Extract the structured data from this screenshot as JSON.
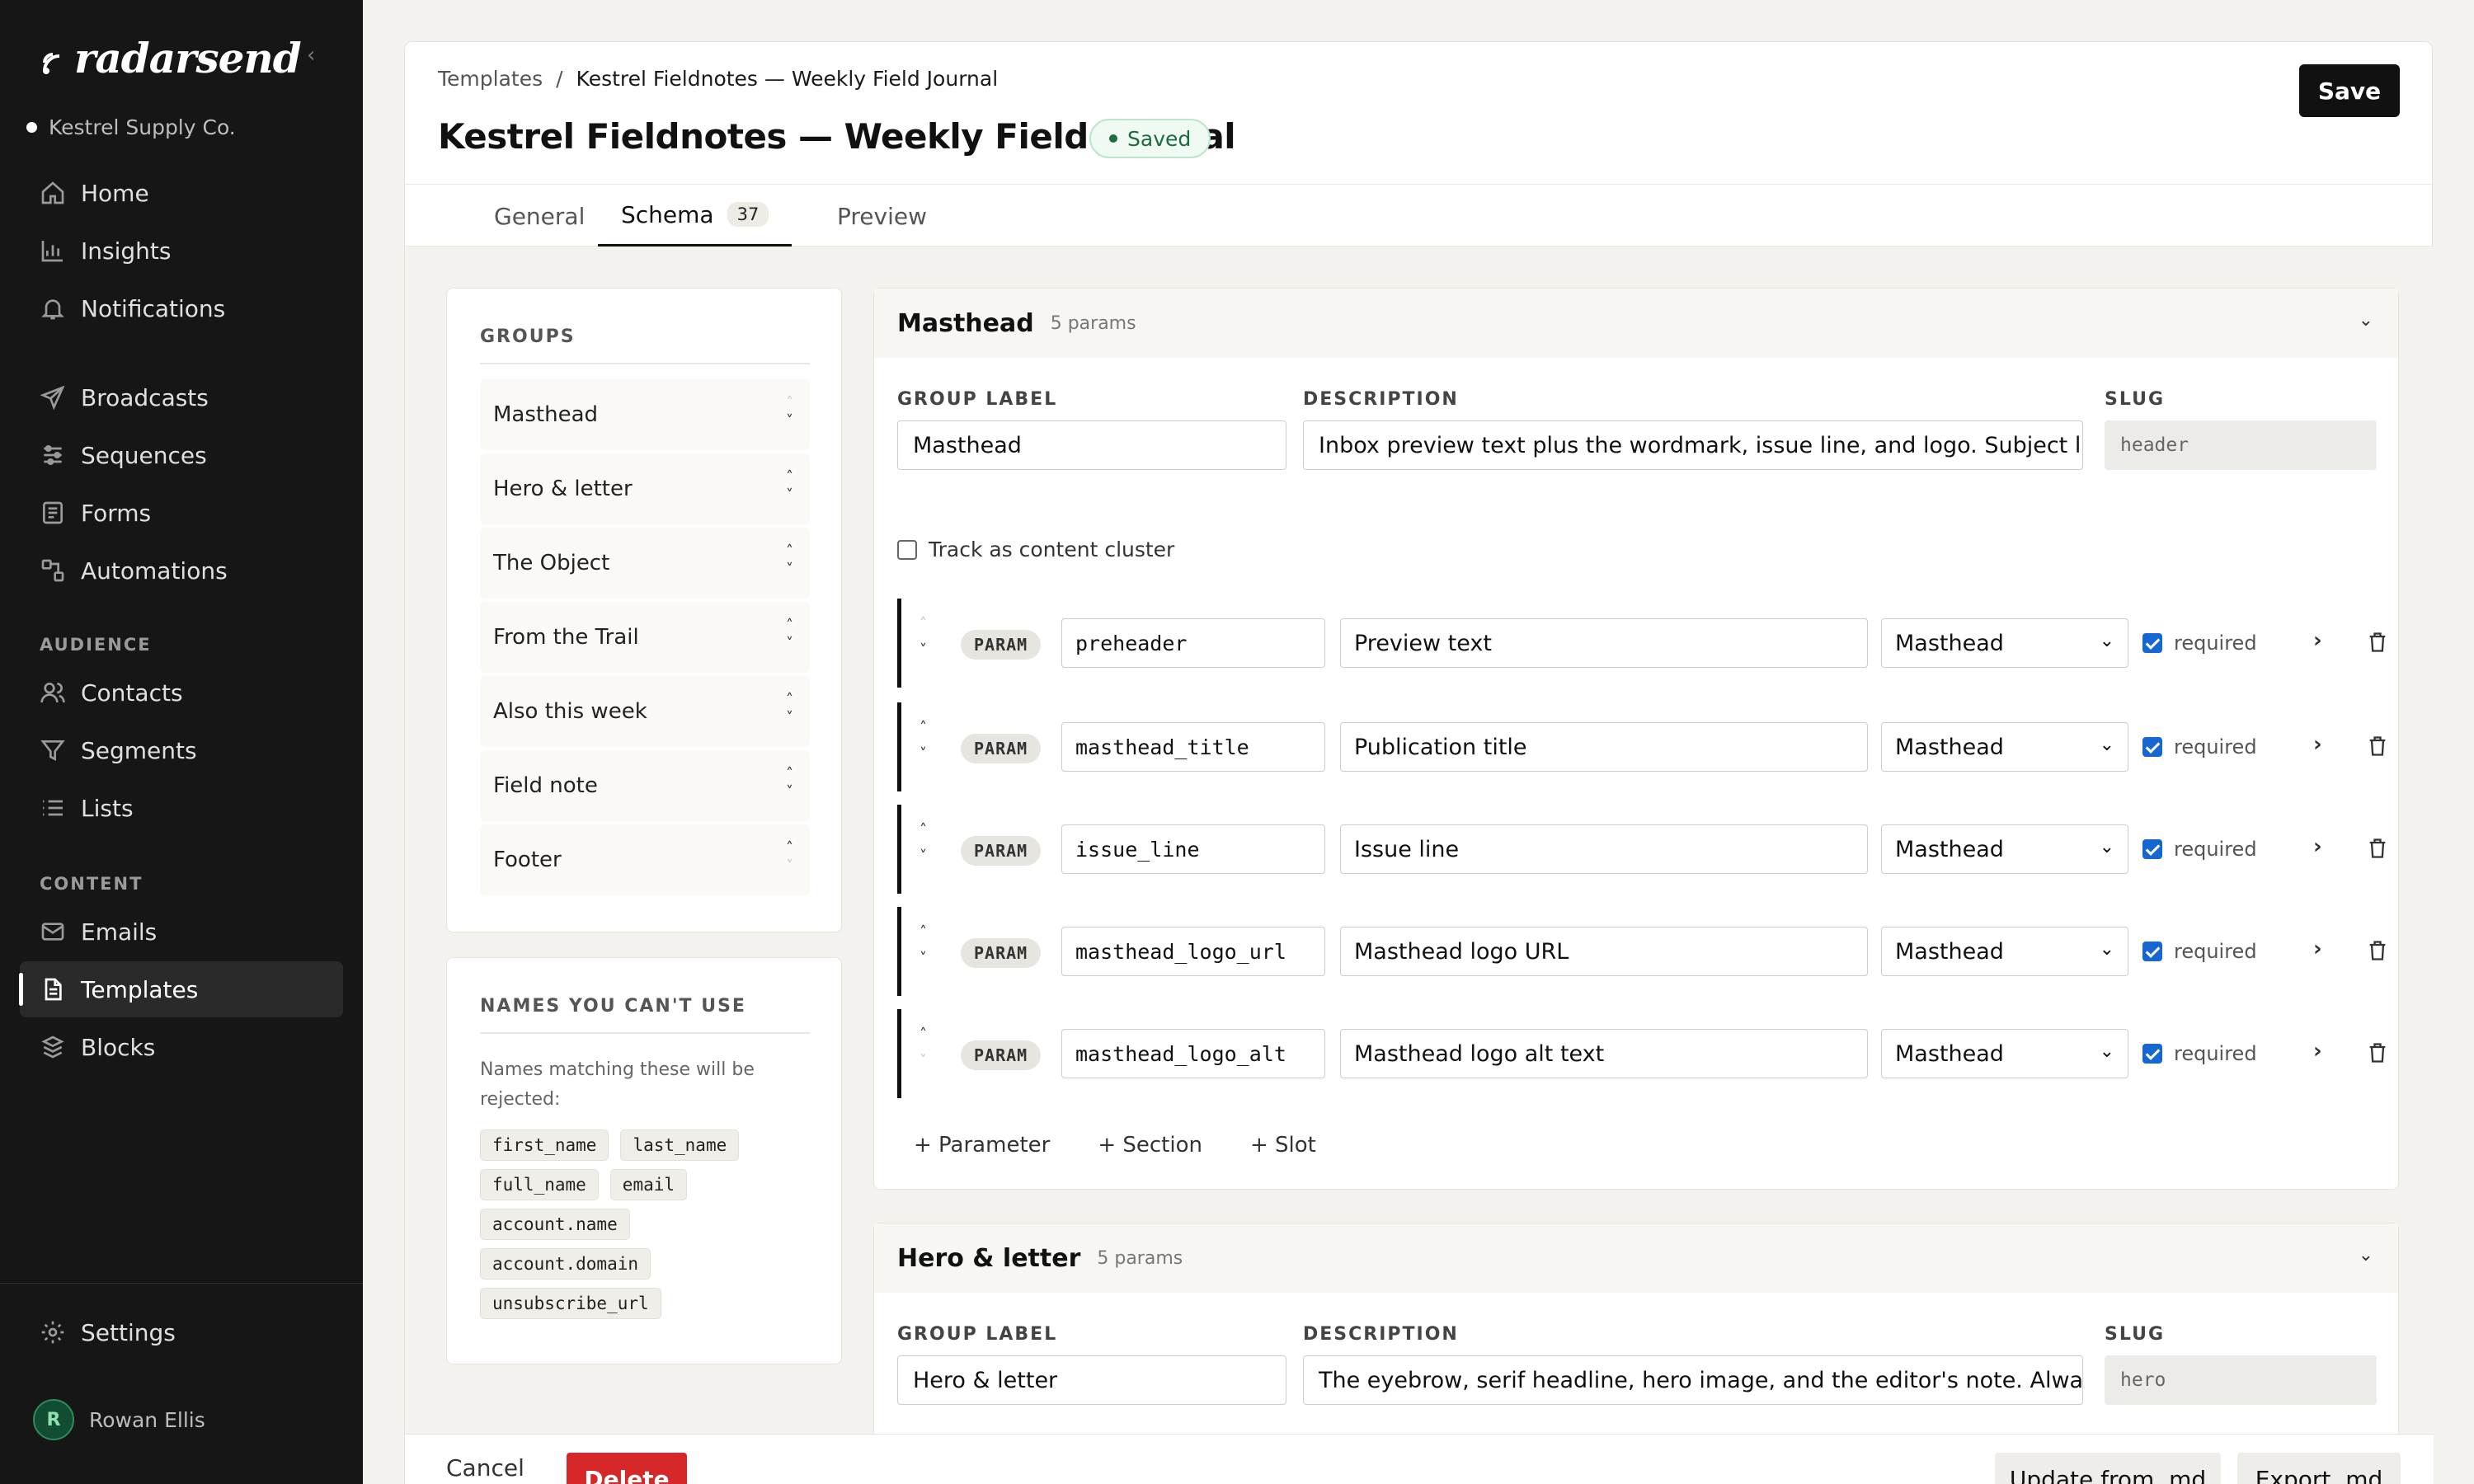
{
  "brand": {
    "name": "radarsend"
  },
  "workspace": {
    "name": "Kestrel Supply Co."
  },
  "nav": {
    "main": [
      {
        "label": "Home",
        "icon": "home-icon"
      },
      {
        "label": "Insights",
        "icon": "bar-chart-icon"
      },
      {
        "label": "Notifications",
        "icon": "bell-icon"
      }
    ],
    "messaging": [
      {
        "label": "Broadcasts",
        "icon": "send-icon"
      },
      {
        "label": "Sequences",
        "icon": "sequence-icon"
      },
      {
        "label": "Forms",
        "icon": "form-icon"
      },
      {
        "label": "Automations",
        "icon": "automation-icon"
      }
    ],
    "audience_heading": "AUDIENCE",
    "audience": [
      {
        "label": "Contacts",
        "icon": "users-icon"
      },
      {
        "label": "Segments",
        "icon": "filter-icon"
      },
      {
        "label": "Lists",
        "icon": "list-icon"
      }
    ],
    "content_heading": "CONTENT",
    "content": [
      {
        "label": "Emails",
        "icon": "mail-icon"
      },
      {
        "label": "Templates",
        "icon": "template-icon",
        "active": true
      },
      {
        "label": "Blocks",
        "icon": "blocks-icon"
      }
    ],
    "settings": "Settings"
  },
  "user": {
    "initial": "R",
    "name": "Rowan Ellis"
  },
  "breadcrumb": {
    "parent": "Templates",
    "sep": "/",
    "current": "Kestrel Fieldnotes — Weekly Field Journal"
  },
  "page": {
    "title": "Kestrel Fieldnotes — Weekly Field Journal",
    "status": "Saved",
    "save_label": "Save"
  },
  "tabs": [
    {
      "label": "General"
    },
    {
      "label": "Schema",
      "count": "37",
      "active": true
    },
    {
      "label": "Preview"
    }
  ],
  "groups_panel": {
    "heading": "GROUPS",
    "items": [
      "Masthead",
      "Hero & letter",
      "The Object",
      "From the Trail",
      "Also this week",
      "Field note",
      "Footer"
    ]
  },
  "reserved": {
    "heading": "NAMES YOU CAN'T USE",
    "description": "Names matching these will be rejected:",
    "names": [
      "first_name",
      "last_name",
      "full_name",
      "email",
      "account.name",
      "account.domain",
      "unsubscribe_url"
    ]
  },
  "labels": {
    "group_label": "GROUP LABEL",
    "description": "DESCRIPTION",
    "slug": "SLUG",
    "track": "Track as content cluster",
    "param_badge": "PARAM",
    "required": "required",
    "add_parameter": "+ Parameter",
    "add_section": "+ Section",
    "add_slot": "+ Slot"
  },
  "masthead": {
    "name": "Masthead",
    "count": "5 params",
    "group_label": "Masthead",
    "description": "Inbox preview text plus the wordmark, issue line, and logo. Subject line is set per issue.",
    "slug": "header",
    "params": [
      {
        "key": "preheader",
        "label": "Preview text",
        "group": "Masthead",
        "required": true
      },
      {
        "key": "masthead_title",
        "label": "Publication title",
        "group": "Masthead",
        "required": true
      },
      {
        "key": "issue_line",
        "label": "Issue line",
        "group": "Masthead",
        "required": true
      },
      {
        "key": "masthead_logo_url",
        "label": "Masthead logo URL",
        "group": "Masthead",
        "required": true
      },
      {
        "key": "masthead_logo_alt",
        "label": "Masthead logo alt text",
        "group": "Masthead",
        "required": true
      }
    ]
  },
  "hero": {
    "name": "Hero & letter",
    "count": "5 params",
    "group_label": "Hero & letter",
    "description": "The eyebrow, serif headline, hero image, and the editor's note. Always renders",
    "slug": "hero"
  },
  "footer": {
    "cancel": "Cancel",
    "delete": "Delete",
    "update": "Update from .md",
    "export": "Export .md"
  }
}
